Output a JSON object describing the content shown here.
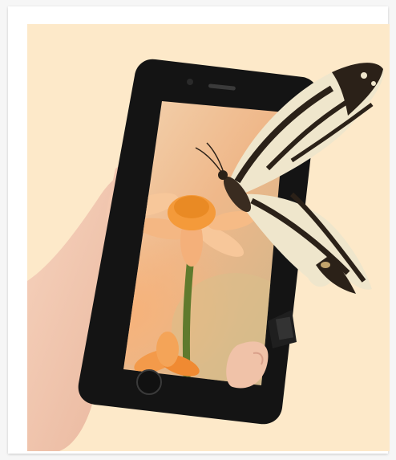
{
  "image": {
    "kind": "product-photo",
    "subject": "phone-lcd-screen-replacement",
    "background_color": "#fde9c9",
    "phone_color": "#141414",
    "accent_flower": "#f49a3a",
    "butterfly_colors": [
      "#2b2118",
      "#efe6cc",
      "#c3a46c"
    ]
  }
}
